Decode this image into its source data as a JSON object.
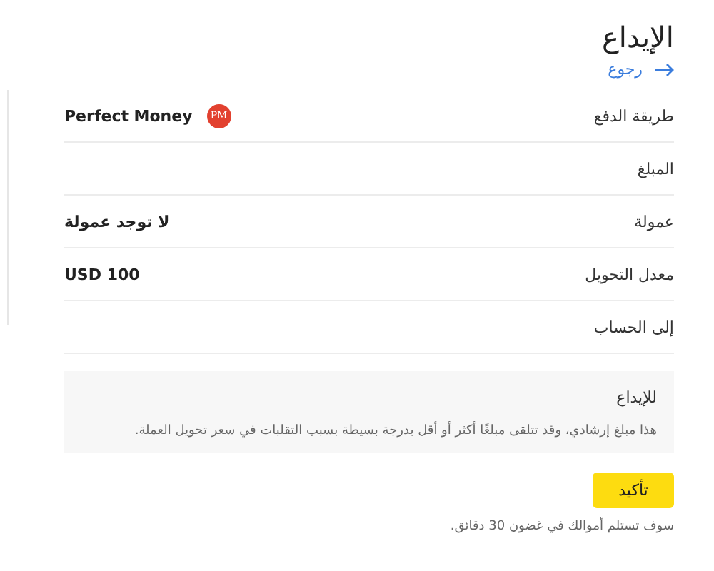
{
  "header": {
    "title": "الإيداع",
    "back_link": "رجوع"
  },
  "summary_rows": [
    {
      "label": "طريقة الدفع",
      "value": "Perfect Money",
      "badge": "PM"
    },
    {
      "label": "المبلغ"
    },
    {
      "label": "عمولة",
      "value": "لا توجد عمولة"
    },
    {
      "label": "معدل التحويل",
      "value": "USD 100"
    },
    {
      "label": "إلى الحساب"
    }
  ],
  "info_box": {
    "title": "للإيداع",
    "note": "هذا مبلغ إرشادي، وقد تتلقى مبلغًا أكثر أو أقل بدرجة بسيطة بسبب التقلبات في سعر تحويل العملة."
  },
  "confirm_button": "تأكيد",
  "footer_note": "سوف تستلم أموالك في غضون 30 دقائق."
}
